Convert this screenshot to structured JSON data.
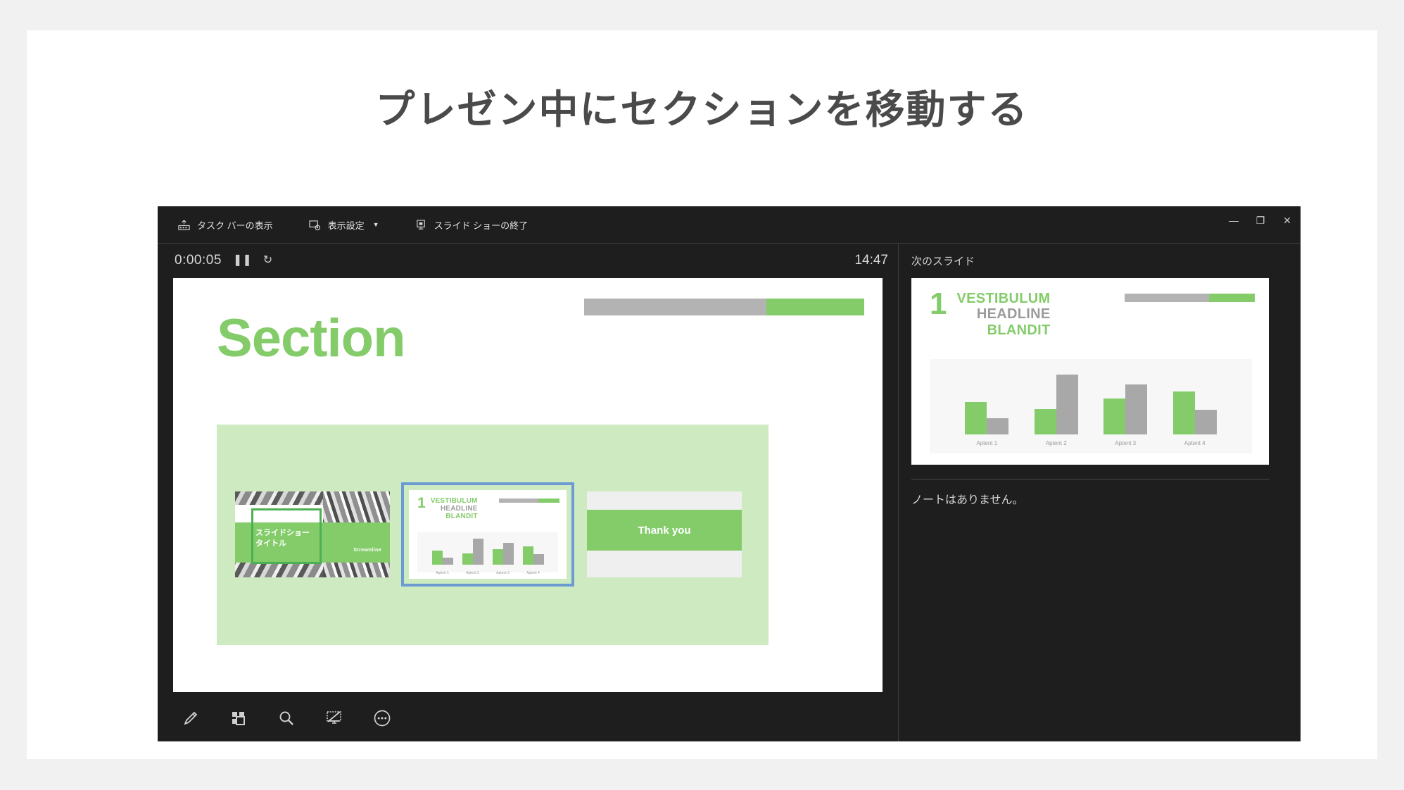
{
  "page": {
    "title": "プレゼン中にセクションを移動する"
  },
  "presenter": {
    "topbar": {
      "items": [
        {
          "label": "タスク バーの表示",
          "icon": "taskbar-icon"
        },
        {
          "label": "表示設定",
          "icon": "display-settings-icon",
          "caret": "▼"
        },
        {
          "label": "スライド ショーの終了",
          "icon": "end-show-icon"
        }
      ]
    },
    "window_controls": {
      "minimize": "—",
      "restore": "❐",
      "close": "✕"
    },
    "timer": {
      "elapsed": "0:00:05",
      "pause": "❚❚",
      "restart": "↻"
    },
    "clock": "14:47",
    "tools": [
      {
        "name": "pen-icon",
        "label": "ペン"
      },
      {
        "name": "all-slides-icon",
        "label": "すべてのスライドを表示"
      },
      {
        "name": "zoom-icon",
        "label": "拡大"
      },
      {
        "name": "black-screen-icon",
        "label": "画面を黒くする"
      },
      {
        "name": "more-options-icon",
        "label": "その他のスライド ショー オプション"
      }
    ],
    "next_pane": {
      "label": "次のスライド",
      "notes": "ノートはありません。"
    }
  },
  "current_slide": {
    "title": "Section",
    "progress": {
      "gray_percent": 65,
      "green_percent": 35
    },
    "thumbnails": [
      {
        "type": "title-slide",
        "title": "スライドショー\nタイトル",
        "brand": "Streamline"
      },
      {
        "type": "chart-slide",
        "selected": true,
        "number": "1",
        "heading_line1": "VESTIBULUM",
        "heading_line2": "HEADLINE",
        "heading_line3": "BLANDIT"
      },
      {
        "type": "closing-slide",
        "text": "Thank you"
      }
    ]
  },
  "next_slide": {
    "number": "1",
    "heading_line1": "VESTIBULUM",
    "heading_line2": "HEADLINE",
    "heading_line3": "BLANDIT"
  },
  "colors": {
    "accent_green": "#84cc6a",
    "panel_green": "#cdeac0",
    "gray_bar": "#a8a8a8",
    "selection_blue": "#6b9bd2",
    "window_bg": "#1e1e1e"
  },
  "chart_data": {
    "type": "bar",
    "title": "VESTIBULUM HEADLINE BLANDIT",
    "categories": [
      "Aptent 1",
      "Aptent 2",
      "Aptent 3",
      "Aptent 4"
    ],
    "series": [
      {
        "name": "Green",
        "color": "#84cc6a",
        "values": [
          48,
          38,
          53,
          63
        ]
      },
      {
        "name": "Gray",
        "color": "#a8a8a8",
        "values": [
          24,
          88,
          74,
          36
        ]
      }
    ],
    "xlabel": "",
    "ylabel": "",
    "ylim": [
      0,
      100
    ],
    "grid": false,
    "legend": "none"
  }
}
